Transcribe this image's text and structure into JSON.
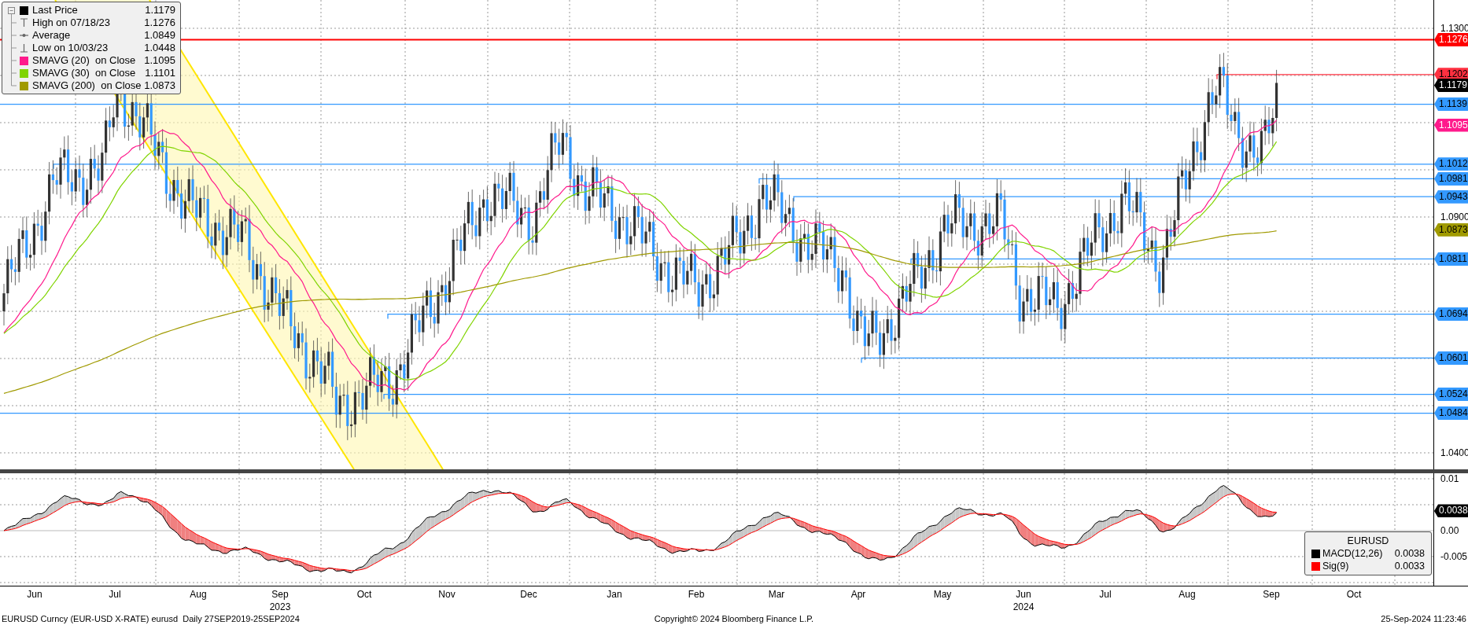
{
  "legend": {
    "items": [
      {
        "kind": "swatch",
        "label": "Last Price",
        "value": "1.1179",
        "color": "#000000"
      },
      {
        "kind": "high",
        "label": "High on 07/18/23",
        "value": "1.1276"
      },
      {
        "kind": "average",
        "label": "Average",
        "value": "1.0849"
      },
      {
        "kind": "low",
        "label": "Low on 10/03/23",
        "value": "1.0448"
      },
      {
        "kind": "swatch",
        "label": "SMAVG (20)  on Close",
        "value": "1.1095",
        "color": "#ff1a8c"
      },
      {
        "kind": "swatch",
        "label": "SMAVG (30)  on Close",
        "value": "1.1101",
        "color": "#80d400"
      },
      {
        "kind": "swatch",
        "label": "SMAVG (200)  on Close",
        "value": "1.0873",
        "color": "#a09a00"
      }
    ]
  },
  "price_axis": {
    "ticks": [
      "1.1300",
      "1.0900",
      "1.0400"
    ]
  },
  "price_tags": [
    {
      "kind": "level",
      "value": "1.1276",
      "color": "#ff0000"
    },
    {
      "kind": "level",
      "value": "1.1202",
      "color": "#ff3040"
    },
    {
      "kind": "marker",
      "value": "1.1179",
      "color": "#000000"
    },
    {
      "kind": "level",
      "value": "1.1139",
      "color": "#3399ff"
    },
    {
      "kind": "marker",
      "value": "1.1095",
      "color": "#ff1a8c"
    },
    {
      "kind": "level",
      "value": "1.1012",
      "color": "#3399ff"
    },
    {
      "kind": "level",
      "value": "1.0981",
      "color": "#3399ff"
    },
    {
      "kind": "level",
      "value": "1.0943",
      "color": "#3399ff"
    },
    {
      "kind": "marker",
      "value": "1.0873",
      "color": "#a09a00"
    },
    {
      "kind": "level",
      "value": "1.0811",
      "color": "#3399ff"
    },
    {
      "kind": "level",
      "value": "1.0694",
      "color": "#3399ff"
    },
    {
      "kind": "level",
      "value": "1.0601",
      "color": "#3399ff"
    },
    {
      "kind": "level",
      "value": "1.0524",
      "color": "#3399ff"
    },
    {
      "kind": "level",
      "value": "1.0484",
      "color": "#3399ff"
    }
  ],
  "macd_panel": {
    "ticks": [
      "0.01",
      "0.00",
      "-0.005"
    ],
    "tag": {
      "value": "0.0038",
      "color": "#000000"
    },
    "legend": {
      "title": "EURUSD",
      "items": [
        {
          "label": "MACD(12,26)",
          "value": "0.0038",
          "color": "#000000"
        },
        {
          "label": "Sig(9)",
          "value": "0.0033",
          "color": "#ff0000"
        }
      ]
    }
  },
  "x_axis": {
    "months": [
      "Jun",
      "Jul",
      "Aug",
      "Sep",
      "Oct",
      "Nov",
      "Dec",
      "Jan",
      "Feb",
      "Mar",
      "Apr",
      "May",
      "Jun",
      "Jul",
      "Aug",
      "Sep",
      "Oct"
    ],
    "years": [
      "2023",
      "2024"
    ]
  },
  "footer": {
    "security": "EURUSD Curncy (EUR-USD X-RATE) eurusd  Daily 27SEP2019-25SEP2024",
    "copyright": "Copyright© 2024 Bloomberg Finance L.P.",
    "timestamp": "25-Sep-2024 11:23:46"
  }
}
